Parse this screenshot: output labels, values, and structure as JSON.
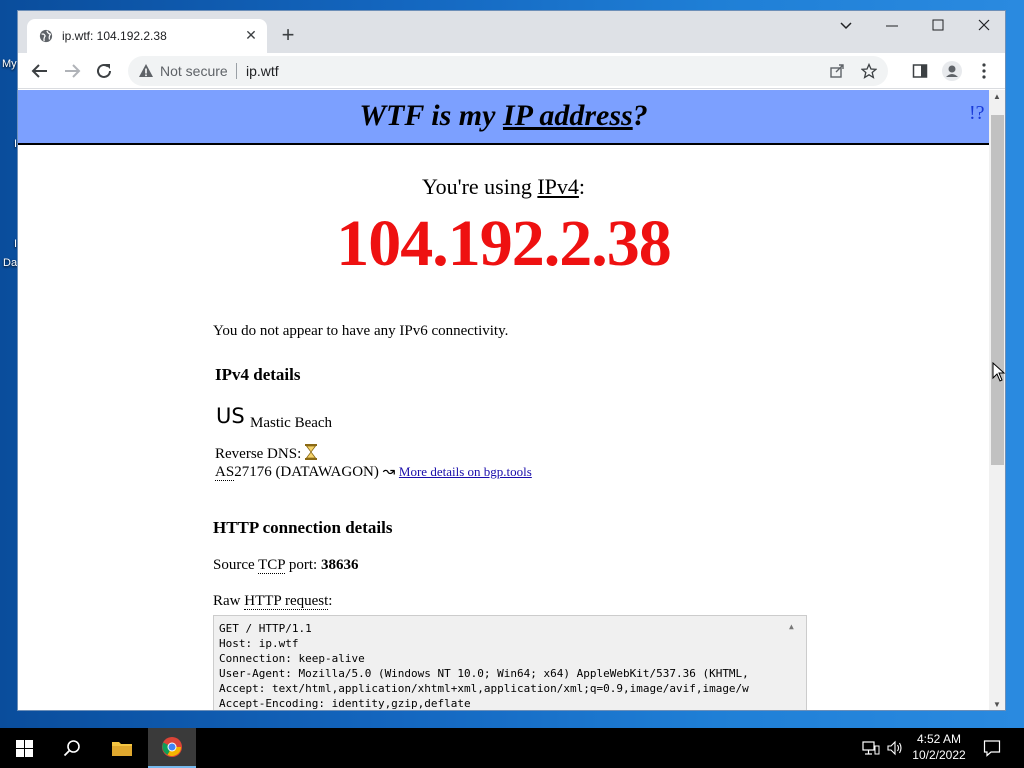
{
  "desktop": {
    "labels": [
      "My",
      "I",
      "I",
      "Da"
    ]
  },
  "browser": {
    "tab_title": "ip.wtf: 104.192.2.38",
    "tab_close_glyph": "✕",
    "newtab_glyph": "+",
    "omnibox": {
      "security_label": "Not secure",
      "url": "ip.wtf"
    }
  },
  "page": {
    "banner": {
      "title_prefix": "WTF is my ",
      "title_link": "IP address",
      "title_suffix": "?",
      "help": "!?"
    },
    "using": {
      "prefix": "You're using ",
      "protocol": "IPv4",
      "suffix": ":"
    },
    "ip": "104.192.2.38",
    "ipv6_note": "You do not appear to have any IPv6 connectivity.",
    "ipv4_heading": "IPv4 details",
    "country_code": "US",
    "city": "Mastic Beach",
    "reverse_dns_label": "Reverse DNS:",
    "as_prefix": "AS",
    "as_rest": "27176 (DATAWAGON) ↝ ",
    "bgp_link": "More details on bgp.tools",
    "http_heading": "HTTP connection details",
    "source_prefix": "Source ",
    "source_tcp": "TCP",
    "source_mid": " port: ",
    "source_port": "38636",
    "raw_label_prefix": "Raw ",
    "raw_label_abbr": "HTTP request",
    "raw_label_suffix": ":",
    "raw_request": "GET / HTTP/1.1\nHost: ip.wtf\nConnection: keep-alive\nUser-Agent: Mozilla/5.0 (Windows NT 10.0; Win64; x64) AppleWebKit/537.36 (KHTML,\nAccept: text/html,application/xhtml+xml,application/xml;q=0.9,image/avif,image/w\nAccept-Encoding: identity,gzip,deflate"
  },
  "taskbar": {
    "time": "4:52 AM",
    "date": "10/2/2022"
  },
  "colors": {
    "banner_bg": "#7ca0ff",
    "ip_red": "#ee1111",
    "link_blue": "#1a0dab"
  }
}
